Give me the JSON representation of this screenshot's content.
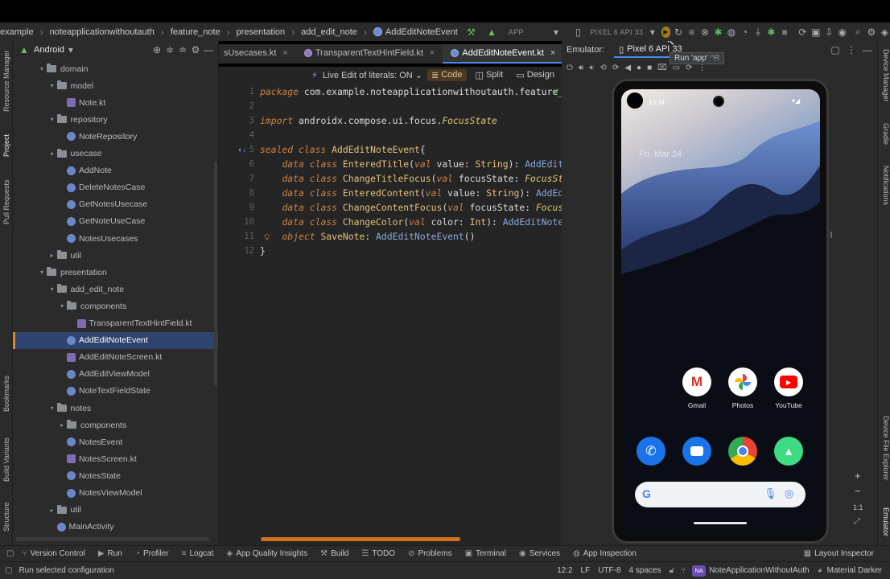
{
  "navbar": {
    "breadcrumbs": [
      "example",
      "noteapplicationwithoutauth",
      "feature_note",
      "presentation",
      "add_edit_note",
      "AddEditNoteEvent"
    ],
    "run_config": "APP",
    "device": "PIXEL 6 API 33"
  },
  "project_panel": {
    "view": "Android",
    "tree": [
      {
        "label": "domain",
        "kind": "folder",
        "depth": 4,
        "arrow": "down"
      },
      {
        "label": "model",
        "kind": "folder",
        "depth": 5,
        "arrow": "down"
      },
      {
        "label": "Note.kt",
        "kind": "kt",
        "depth": 6
      },
      {
        "label": "repository",
        "kind": "folder",
        "depth": 5,
        "arrow": "down"
      },
      {
        "label": "NoteRepository",
        "kind": "class",
        "depth": 6
      },
      {
        "label": "usecase",
        "kind": "folder",
        "depth": 5,
        "arrow": "down"
      },
      {
        "label": "AddNote",
        "kind": "class",
        "depth": 6
      },
      {
        "label": "DeleteNotesCase",
        "kind": "class",
        "depth": 6
      },
      {
        "label": "GetNotesUsecase",
        "kind": "class",
        "depth": 6
      },
      {
        "label": "GetNoteUseCase",
        "kind": "class",
        "depth": 6
      },
      {
        "label": "NotesUsecases",
        "kind": "class",
        "depth": 6
      },
      {
        "label": "util",
        "kind": "folder",
        "depth": 5,
        "arrow": "right"
      },
      {
        "label": "presentation",
        "kind": "folder",
        "depth": 4,
        "arrow": "down"
      },
      {
        "label": "add_edit_note",
        "kind": "folder",
        "depth": 5,
        "arrow": "down"
      },
      {
        "label": "components",
        "kind": "folder",
        "depth": 6,
        "arrow": "down"
      },
      {
        "label": "TransparentTextHintField.kt",
        "kind": "kt",
        "depth": 7
      },
      {
        "label": "AddEditNoteEvent",
        "kind": "class",
        "depth": 6,
        "selected": true
      },
      {
        "label": "AddEditNoteScreen.kt",
        "kind": "kt",
        "depth": 6
      },
      {
        "label": "AddEditViewModel",
        "kind": "class",
        "depth": 6
      },
      {
        "label": "NoteTextFieldState",
        "kind": "class",
        "depth": 6
      },
      {
        "label": "notes",
        "kind": "folder",
        "depth": 5,
        "arrow": "down"
      },
      {
        "label": "components",
        "kind": "folder",
        "depth": 6,
        "arrow": "right"
      },
      {
        "label": "NotesEvent",
        "kind": "class",
        "depth": 6
      },
      {
        "label": "NotesScreen.kt",
        "kind": "kt",
        "depth": 6
      },
      {
        "label": "NotesState",
        "kind": "class",
        "depth": 6
      },
      {
        "label": "NotesViewModel",
        "kind": "class",
        "depth": 6
      },
      {
        "label": "util",
        "kind": "folder",
        "depth": 5,
        "arrow": "right"
      },
      {
        "label": "MainActivity",
        "kind": "class",
        "depth": 5
      }
    ]
  },
  "editor": {
    "tabs": [
      "sUsecases.kt",
      "TransparentTextHintField.kt",
      "AddEditNoteEvent.kt"
    ],
    "active_tab": "AddEditNoteEvent.kt",
    "live_edit": "Live Edit of literals: ON",
    "modes": [
      "Code",
      "Split",
      "Design"
    ],
    "line_numbers": [
      "1",
      "2",
      "3",
      "4",
      "5",
      "6",
      "7",
      "8",
      "9",
      "10",
      "11",
      "12"
    ]
  },
  "emulator": {
    "label": "Emulator:",
    "device_tab": "Pixel 6 API 33",
    "tooltip": "Run 'app'",
    "tooltip_shortcut": "^R",
    "phone": {
      "time": "10:34",
      "date": "Fri, Mar 24",
      "apps_row1": [
        "Gmail",
        "Photos",
        "YouTube"
      ],
      "zoom_label": "1:1"
    }
  },
  "left_strip": [
    "Resource Manager",
    "Project",
    "Pull Requests",
    "Bookmarks",
    "Build Variants",
    "Structure"
  ],
  "right_strip": [
    "Device Manager",
    "Gradle",
    "Notifications",
    "Device File Explorer",
    "Emulator"
  ],
  "bottom_tools": [
    "Version Control",
    "Run",
    "Profiler",
    "Logcat",
    "App Quality Insights",
    "Build",
    "TODO",
    "Problems",
    "Terminal",
    "Services",
    "App Inspection",
    "Layout Inspector"
  ],
  "status": {
    "message": "Run selected configuration",
    "position": "12:2",
    "line_sep": "LF",
    "encoding": "UTF-8",
    "indent": "4 spaces",
    "project_badge": "NA",
    "project": "NoteApplicationWithoutAuth",
    "theme": "Material Darker"
  }
}
